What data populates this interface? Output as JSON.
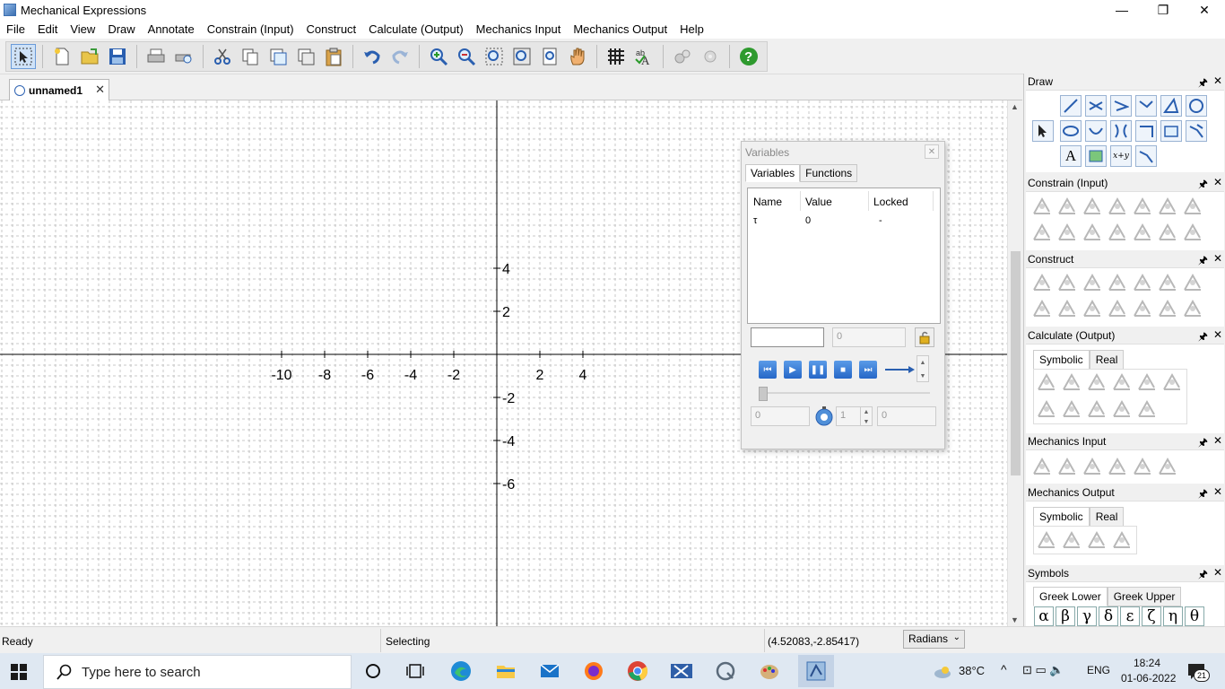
{
  "window": {
    "title": "Mechanical Expressions",
    "minimize": "—",
    "maximize": "❐",
    "close": "✕"
  },
  "menu": [
    "File",
    "Edit",
    "View",
    "Draw",
    "Annotate",
    "Constrain (Input)",
    "Construct",
    "Calculate (Output)",
    "Mechanics Input",
    "Mechanics Output",
    "Help"
  ],
  "document_tab": {
    "label": "unnamed1",
    "close": "✕"
  },
  "canvas": {
    "x_ticks": [
      "-10",
      "-8",
      "-6",
      "-4",
      "-2",
      "2",
      "4"
    ],
    "y_ticks": [
      "4",
      "2",
      "-2",
      "-4",
      "-6"
    ]
  },
  "variables_window": {
    "title": "Variables",
    "tabs": [
      "Variables",
      "Functions"
    ],
    "columns": [
      "Name",
      "Value",
      "Locked"
    ],
    "rows": [
      {
        "name": "τ",
        "value": "0",
        "locked": "-"
      }
    ],
    "value_field": "0",
    "start_field": "0",
    "step_field": "1",
    "end_field": "0"
  },
  "panels": {
    "draw": "Draw",
    "draw_text_tool": "A",
    "constrain": "Constrain (Input)",
    "construct": "Construct",
    "calculate": "Calculate (Output)",
    "calc_tabs": [
      "Symbolic",
      "Real"
    ],
    "mech_input": "Mechanics Input",
    "mech_output": "Mechanics Output",
    "mech_out_tabs": [
      "Symbolic",
      "Real"
    ],
    "symbols": "Symbols",
    "symbol_tabs": [
      "Greek Lower",
      "Greek Upper"
    ],
    "greek": [
      "α",
      "β",
      "γ",
      "δ",
      "ε",
      "ζ",
      "η",
      "θ"
    ],
    "pin": "🖈",
    "close": "✕"
  },
  "status": {
    "left": "Ready",
    "mode": "Selecting",
    "coords": "(4.52083,-2.85417)",
    "angle_unit": "Radians"
  },
  "taskbar": {
    "search_placeholder": "Type here to search",
    "weather": "38°C",
    "lang": "ENG",
    "time": "18:24",
    "date": "01-06-2022",
    "notif_count": "21"
  }
}
